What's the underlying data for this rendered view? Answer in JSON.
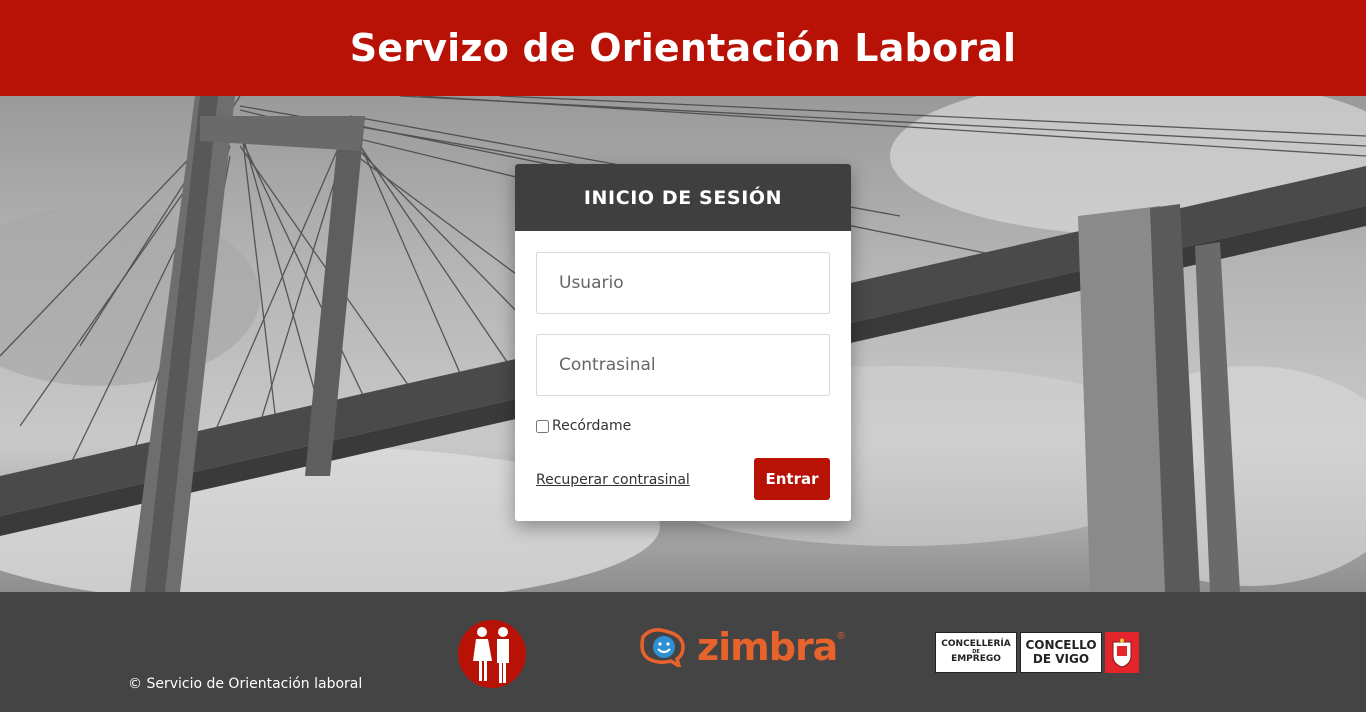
{
  "header": {
    "title": "Servizo de Orientación Laboral"
  },
  "login": {
    "title": "INICIO DE SESIÓN",
    "username_placeholder": "Usuario",
    "password_placeholder": "Contrasinal",
    "remember_label": "Recórdame",
    "recover_link": "Recuperar contrasinal",
    "submit_label": "Entrar"
  },
  "footer": {
    "copyright": "© Servicio de Orientación laboral",
    "zimbra_word": "zimbra",
    "zimbra_reg": "®",
    "concelleria_line1": "CONCELLERÍA",
    "concelleria_line2": "DE",
    "concelleria_line3": "EMPREGO",
    "concello_line1": "CONCELLO",
    "concello_line2": "DE VIGO"
  },
  "colors": {
    "brand_red": "#b81206",
    "dark": "#444444",
    "zimbra_orange": "#e8622c"
  }
}
